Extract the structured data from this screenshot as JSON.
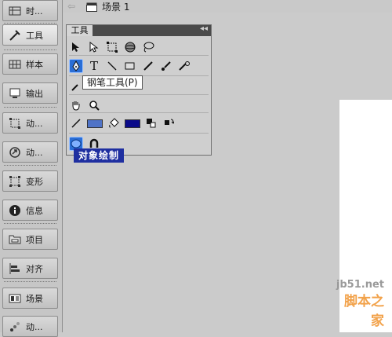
{
  "dock": {
    "items": [
      {
        "label": "时...",
        "icon": "timeline-icon"
      },
      {
        "label": "工具",
        "icon": "tools-icon"
      },
      {
        "label": "样本",
        "icon": "swatches-icon"
      },
      {
        "label": "输出",
        "icon": "output-icon"
      },
      {
        "label": "动...",
        "icon": "motion-editor-icon"
      },
      {
        "label": "动...",
        "icon": "motion-presets-icon"
      },
      {
        "label": "变形",
        "icon": "transform-icon"
      },
      {
        "label": "信息",
        "icon": "info-icon"
      },
      {
        "label": "项目",
        "icon": "library-icon"
      },
      {
        "label": "对齐",
        "icon": "align-icon"
      },
      {
        "label": "场景",
        "icon": "scene-icon"
      },
      {
        "label": "动...",
        "icon": "motion-icon"
      }
    ]
  },
  "topbar": {
    "scene_label": "场景 1"
  },
  "tools_panel": {
    "title": "工具",
    "tooltip": "钢笔工具(P)",
    "object_drawing_label": "对象绘制",
    "stroke_color": "#4f73c7",
    "fill_color": "#0b0b8a",
    "accent": "#2a6ed6"
  },
  "watermark": {
    "url": "jb51.net",
    "name": "脚本之家"
  }
}
